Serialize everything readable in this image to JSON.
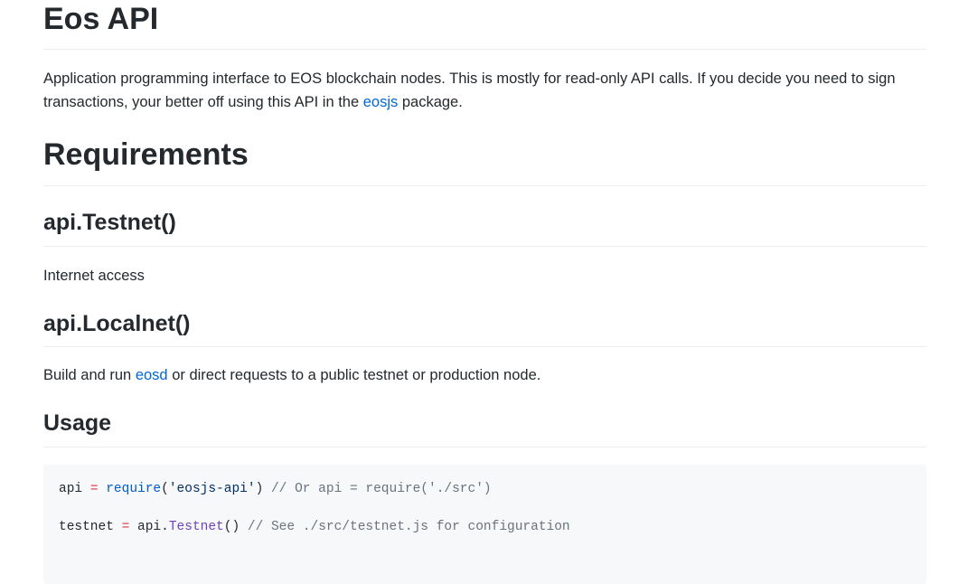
{
  "title": "Eos API",
  "intro": {
    "text1": "Application programming interface to EOS blockchain nodes. This is mostly for read-only API calls. If you decide you need to sign transactions, your better off using this API in the ",
    "link": "eosjs",
    "text2": " package."
  },
  "requirements": {
    "heading": "Requirements",
    "testnet": {
      "heading": "api.Testnet()",
      "text": "Internet access"
    },
    "localnet": {
      "heading": "api.Localnet()",
      "text1": "Build and run ",
      "link": "eosd",
      "text2": " or direct requests to a public testnet or production node."
    }
  },
  "usage": {
    "heading": "Usage",
    "line1": {
      "var": "api",
      "op": "=",
      "fn": "require",
      "p1": "(",
      "str": "'eosjs-api'",
      "p2": ")",
      "comment": "// Or api = require('./src')"
    },
    "line2": {
      "var": "testnet",
      "op": "=",
      "obj": "api.",
      "fn": "Testnet",
      "p": "()",
      "comment": "// See ./src/testnet.js for configuration"
    }
  }
}
